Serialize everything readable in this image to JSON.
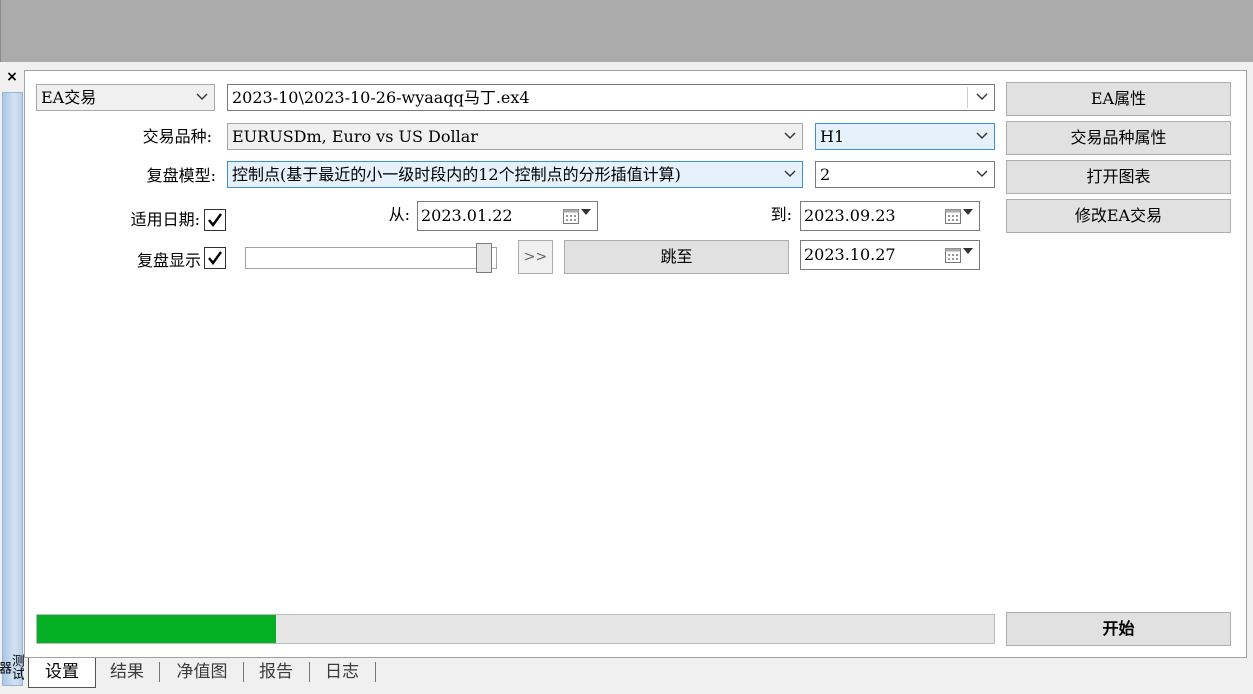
{
  "window": {
    "close_label": "×",
    "side_label": "测试器"
  },
  "header": {
    "mode_combo": "EA交易",
    "expert_file": "2023-10\\2023-10-26-wyaaqq马丁.ex4",
    "symbol_label": "交易品种:",
    "symbol_value": "EURUSDm, Euro vs US Dollar",
    "period_value": "H1",
    "model_label": "复盘模型:",
    "model_value": "控制点(基于最近的小一级时段内的12个控制点的分形插值计算)",
    "spread_value": "2",
    "use_date_label": "适用日期:",
    "use_date_checked": true,
    "from_label": "从:",
    "from_date": "2023.01.22",
    "to_label": "到:",
    "to_date": "2023.09.23",
    "visual_label": "复盘显示",
    "visual_checked": true,
    "skip_button": ">>",
    "jump_label": "跳至",
    "jump_date": "2023.10.27",
    "slider_value_percent": 98
  },
  "buttons": {
    "ea_props": "EA属性",
    "symbol_props": "交易品种属性",
    "open_chart": "打开图表",
    "modify_ea": "修改EA交易",
    "start": "开始"
  },
  "progress": {
    "value_percent": 25
  },
  "tabs": [
    {
      "label": "设置",
      "active": true
    },
    {
      "label": "结果",
      "active": false
    },
    {
      "label": "净值图",
      "active": false
    },
    {
      "label": "报告",
      "active": false
    },
    {
      "label": "日志",
      "active": false
    }
  ],
  "colors": {
    "progress_fill": "#06b025",
    "topbar": "#ababab",
    "highlight_border": "#3c8fd8"
  }
}
